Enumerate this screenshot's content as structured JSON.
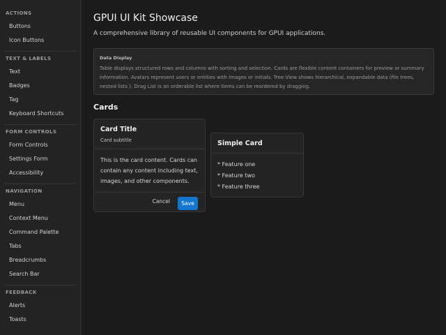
{
  "sidebar": {
    "sections": [
      {
        "title": "ACTIONS",
        "items": [
          "Buttons",
          "Icon Buttons"
        ]
      },
      {
        "title": "TEXT & LABELS",
        "items": [
          "Text",
          "Badges",
          "Tag",
          "Keyboard Shortcuts"
        ]
      },
      {
        "title": "FORM CONTROLS",
        "items": [
          "Form Controls",
          "Settings Form",
          "Accessibility"
        ]
      },
      {
        "title": "NAVIGATION",
        "items": [
          "Menu",
          "Context Menu",
          "Command Palette",
          "Tabs",
          "Breadcrumbs",
          "Search Bar"
        ]
      },
      {
        "title": "FEEDBACK",
        "items": [
          "Alerts",
          "Toasts"
        ]
      }
    ]
  },
  "main": {
    "title": "GPUI UI Kit Showcase",
    "description": "A comprehensive library of reusable UI components for GPUI applications.",
    "info": {
      "title": "Data Display",
      "body": "Table displays structured rows and columns with sorting and selection. Cards are flexible content containers for preview or summary information. Avatars represent users or entities with images or initials. Tree View shows hierarchical, expandable data (file trees, nested lists ). Drag List is an orderable list where items can be reordered by dragging."
    },
    "section_heading": "Cards",
    "card1": {
      "title": "Card Title",
      "subtitle": "Card subtitle",
      "content": "This is the card content. Cards can contain any content including text, images, and other components.",
      "cancel_label": "Cancel",
      "save_label": "Save"
    },
    "card2": {
      "title": "Simple Card",
      "features": [
        "* Feature one",
        "* Feature two",
        "* Feature three"
      ]
    }
  },
  "colors": {
    "background": "#1b1b1b",
    "sidebar": "#232323",
    "accent": "#1477cf"
  }
}
